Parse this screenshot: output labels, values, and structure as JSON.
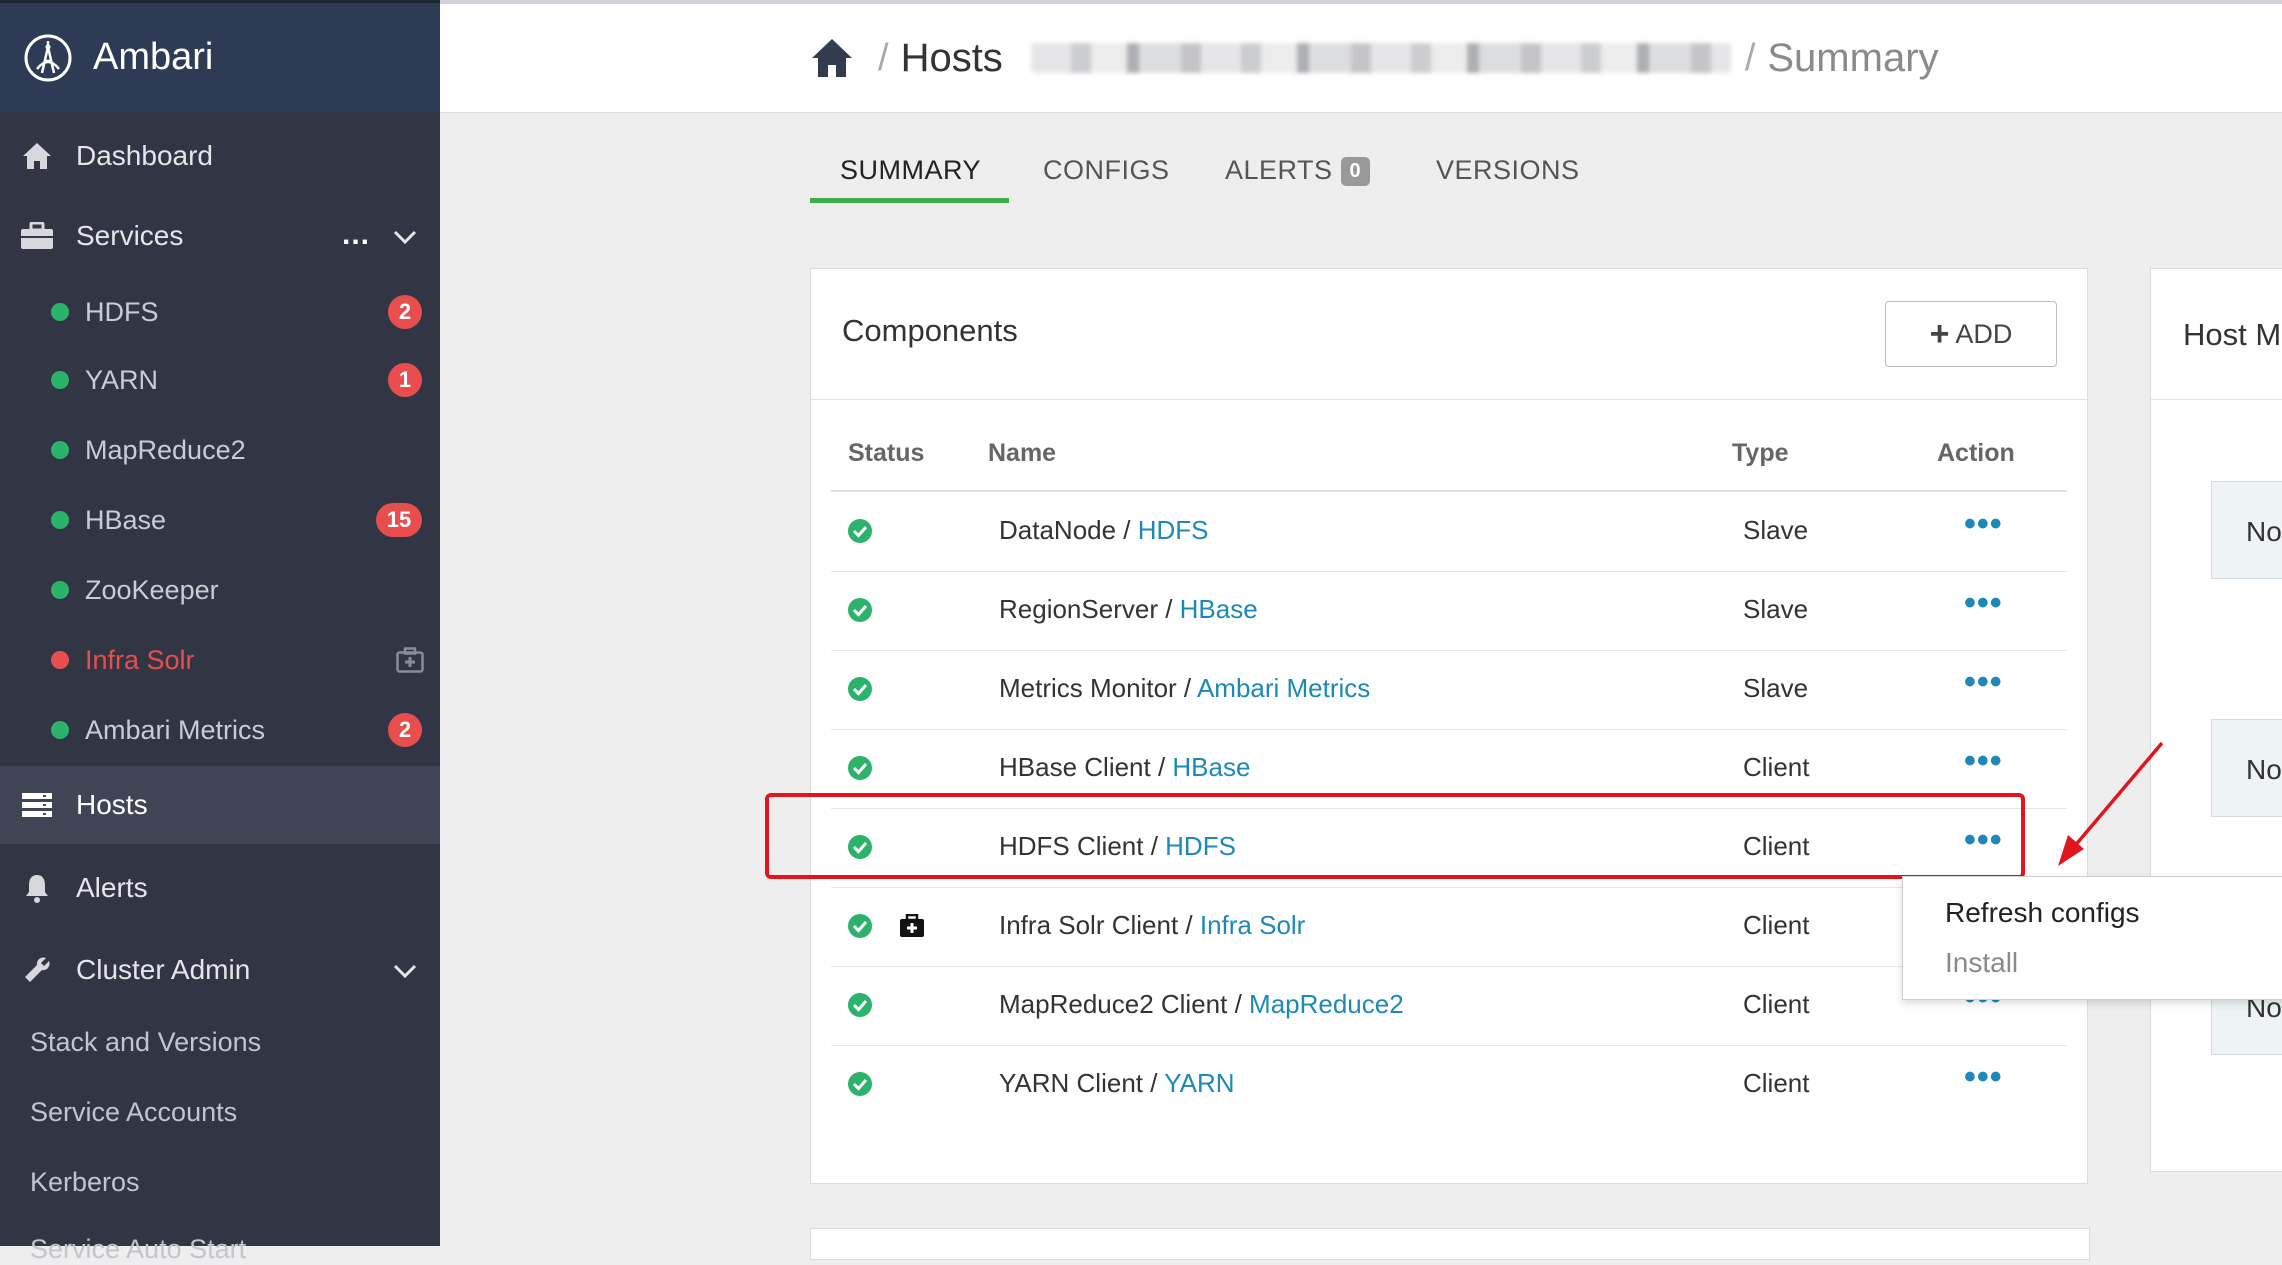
{
  "app": {
    "name": "Ambari"
  },
  "sidebar": {
    "dashboard": "Dashboard",
    "services": {
      "label": "Services",
      "more": "..."
    },
    "service_items": [
      {
        "label": "HDFS",
        "status": "green",
        "badge": "2"
      },
      {
        "label": "YARN",
        "status": "green",
        "badge": "1"
      },
      {
        "label": "MapReduce2",
        "status": "green",
        "badge": ""
      },
      {
        "label": "HBase",
        "status": "green",
        "badge": "15"
      },
      {
        "label": "ZooKeeper",
        "status": "green",
        "badge": ""
      },
      {
        "label": "Infra Solr",
        "status": "red",
        "badge": ""
      },
      {
        "label": "Ambari Metrics",
        "status": "green",
        "badge": "2"
      }
    ],
    "hosts": "Hosts",
    "alerts": "Alerts",
    "cluster_admin": "Cluster Admin",
    "cluster_admin_items": [
      "Stack and Versions",
      "Service Accounts",
      "Kerberos",
      "Service Auto Start"
    ]
  },
  "breadcrumb": {
    "hosts": "Hosts",
    "sep": "/",
    "current": "Summary"
  },
  "tabs": [
    {
      "label": "SUMMARY",
      "active": true
    },
    {
      "label": "CONFIGS"
    },
    {
      "label": "ALERTS",
      "badge": "0"
    },
    {
      "label": "VERSIONS"
    }
  ],
  "components": {
    "title": "Components",
    "add_label": "ADD",
    "columns": [
      "Status",
      "Name",
      "Type",
      "Action"
    ],
    "rows": [
      {
        "name": "DataNode / ",
        "service": "HDFS",
        "type": "Slave",
        "action": "•••"
      },
      {
        "name": "RegionServer / ",
        "service": "HBase",
        "type": "Slave",
        "action": "•••"
      },
      {
        "name": "Metrics Monitor / ",
        "service": "Ambari Metrics",
        "type": "Slave",
        "action": "•••"
      },
      {
        "name": "HBase Client / ",
        "service": "HBase",
        "type": "Client",
        "action": "•••"
      },
      {
        "name": "HDFS Client / ",
        "service": "HDFS",
        "type": "Client",
        "action": "•••"
      },
      {
        "name": "Infra Solr Client / ",
        "service": "Infra Solr",
        "type": "Client",
        "action": "•••"
      },
      {
        "name": "MapReduce2 Client / ",
        "service": "MapReduce2",
        "type": "Client",
        "action": "•••"
      },
      {
        "name": "YARN Client / ",
        "service": "YARN",
        "type": "Client",
        "action": "•••"
      }
    ]
  },
  "dropdown": {
    "items": [
      "Refresh configs",
      "Install"
    ]
  },
  "right_panel": {
    "title": "Host M",
    "boxes": [
      "No",
      "No",
      "No"
    ]
  },
  "colors": {
    "green": "#2cb36b",
    "red": "#e84e4e",
    "link": "#1e88b8",
    "highlight": "#e0161c"
  }
}
